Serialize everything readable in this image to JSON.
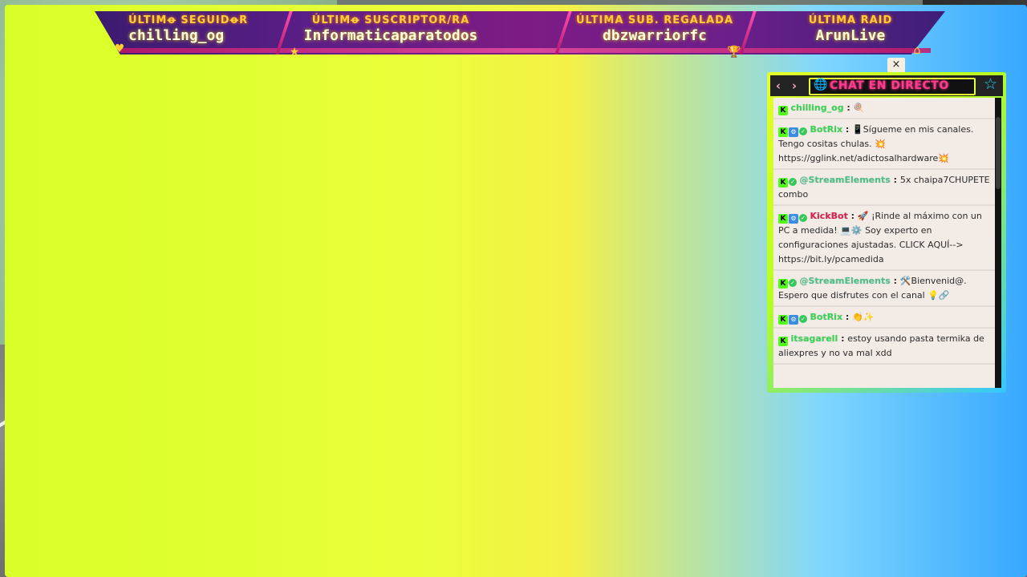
{
  "banner": {
    "slots": [
      {
        "caption": "ÚLTIMꝋ SEGUIDꝋR",
        "name": "chilling_og",
        "icon": "heart-icon"
      },
      {
        "caption": "ÚLTIMꝋ SUSCRIPTOR/RA",
        "name": "Informaticaparatodos",
        "icon": "star-icon"
      },
      {
        "caption": "ÚLTIMA SUB. REGALADA",
        "name": "dbzwarriorfc",
        "icon": "trophy-icon"
      },
      {
        "caption": "ÚLTIMA RAID",
        "name": "ArunLive",
        "icon": "house-icon"
      }
    ]
  },
  "chat": {
    "title": "CHAT EN DIRECTO",
    "close_glyph": "×",
    "prev_glyph": "‹",
    "next_glyph": "›",
    "globe_glyph": "🌐",
    "star_glyph": "☆",
    "messages": [
      {
        "user": "chilling_og",
        "color": "#39d353",
        "bot": false,
        "verified": false,
        "text": "🍭"
      },
      {
        "user": "BotRix",
        "color": "#39d353",
        "bot": true,
        "verified": true,
        "text": "📱Sígueme en mis canales. Tengo cositas chulas. 💥 https://gglink.net/adictosalhardware💥"
      },
      {
        "user": "@StreamElements",
        "color": "#4dbf8a",
        "bot": false,
        "verified": true,
        "text": "5x chaipa7CHUPETE combo"
      },
      {
        "user": "KickBot",
        "color": "#d6224b",
        "bot": true,
        "verified": true,
        "text": "🚀 ¡Rinde al máximo con un PC a medida! 💻⚙️ Soy experto en configuraciones ajustadas. CLICK AQUÍ--> https://bit.ly/pcamedida"
      },
      {
        "user": "@StreamElements",
        "color": "#4dbf8a",
        "bot": false,
        "verified": true,
        "text": "🛠️Bienvenid@. Espero que disfrutes con el canal 💡🔗"
      },
      {
        "user": "BotRix",
        "color": "#39d353",
        "bot": true,
        "verified": true,
        "text": "👏✨"
      },
      {
        "user": "itsagarell",
        "color": "#39d353",
        "bot": false,
        "verified": false,
        "text": "estoy usando pasta termika de aliexpres y no va mal xdd"
      }
    ]
  },
  "colors": {
    "accent_yellow": "#e5ff2a",
    "accent_pink": "#ff3c8e",
    "banner_purple": "#5a1e86",
    "kick_green": "#53fc18"
  }
}
